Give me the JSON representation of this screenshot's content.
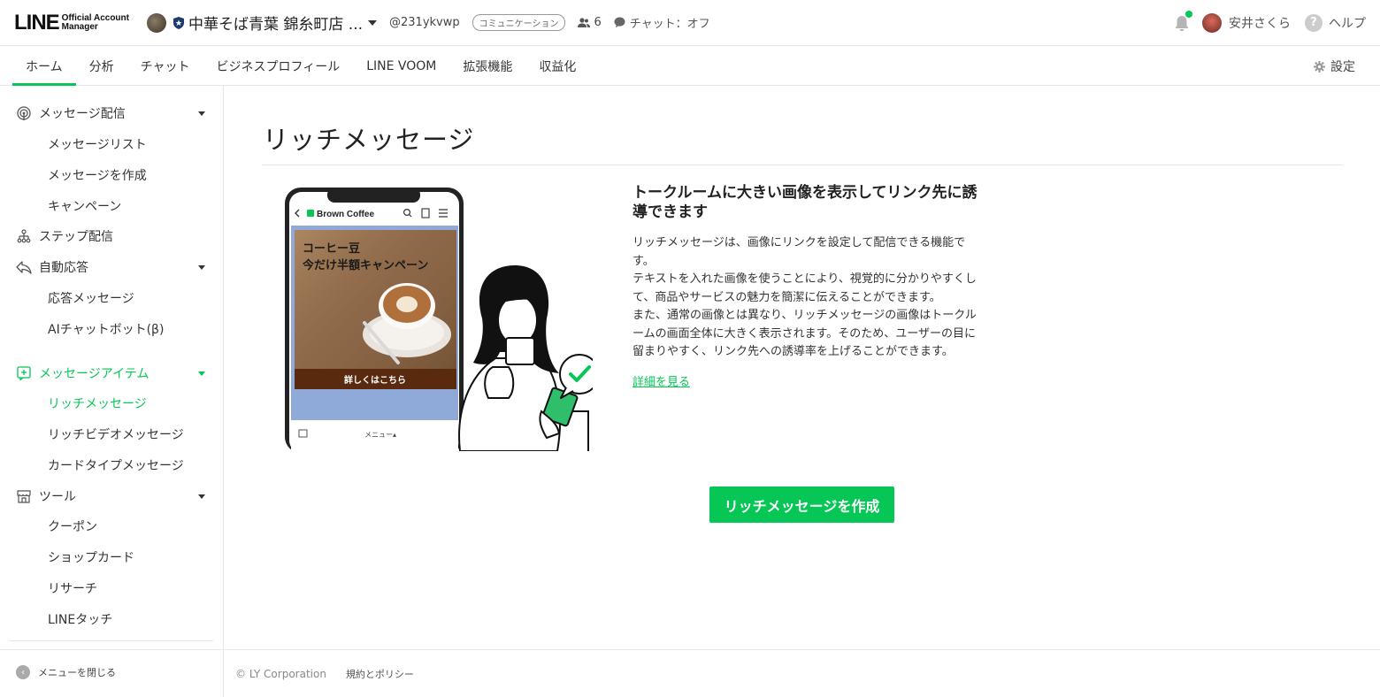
{
  "header": {
    "logo_main": "LINE",
    "logo_sub1": "Official Account",
    "logo_sub2": "Manager",
    "account_name": "中華そば青葉 錦糸町店 ...",
    "account_id": "@231ykvwp",
    "plan_badge": "コミュニケーション",
    "friend_count": "6",
    "chat_status": "チャット：オフ",
    "user_name": "安井さくら",
    "help_label": "ヘルプ"
  },
  "nav": {
    "tabs": [
      "ホーム",
      "分析",
      "チャット",
      "ビジネスプロフィール",
      "LINE VOOM",
      "拡張機能",
      "収益化"
    ],
    "active_tab": "ホーム",
    "settings_label": "設定"
  },
  "sidebar": {
    "sections": [
      {
        "label": "メッセージ配信",
        "icon": "broadcast-icon",
        "items": [
          "メッセージリスト",
          "メッセージを作成",
          "キャンペーン"
        ]
      },
      {
        "label": "ステップ配信",
        "icon": "step-icon",
        "items": []
      },
      {
        "label": "自動応答",
        "icon": "reply-icon",
        "items": [
          "応答メッセージ",
          "AIチャットボット(β)"
        ]
      },
      {
        "label": "メッセージアイテム",
        "icon": "message-item-icon",
        "items": [
          "リッチメッセージ",
          "リッチビデオメッセージ",
          "カードタイプメッセージ"
        ]
      },
      {
        "label": "ツール",
        "icon": "tool-icon",
        "items": [
          "クーポン",
          "ショップカード",
          "リサーチ",
          "LINEタッチ"
        ]
      }
    ],
    "active_item": "リッチメッセージ",
    "close_menu_label": "メニューを閉じる"
  },
  "main": {
    "title": "リッチメッセージ",
    "illustration": {
      "chat_name": "Brown Coffee",
      "banner_line1": "コーヒー豆",
      "banner_line2": "今だけ半額キャンペーン",
      "banner_button": "詳しくはこちら",
      "menu_label": "メニュー▴"
    },
    "desc_title": "トークルームに大きい画像を表示してリンク先に誘導できます",
    "desc_body": "リッチメッセージは、画像にリンクを設定して配信できる機能です。\nテキストを入れた画像を使うことにより、視覚的に分かりやすくして、商品やサービスの魅力を簡潔に伝えることができます。\nまた、通常の画像とは異なり、リッチメッセージの画像はトークルームの画面全体に大きく表示されます。そのため、ユーザーの目に留まりやすく、リンク先への誘導率を上げることができます。",
    "details_link": "詳細を見る",
    "create_button": "リッチメッセージを作成"
  },
  "footer": {
    "copyright": "© LY Corporation",
    "policy": "規約とポリシー"
  },
  "colors": {
    "accent": "#06c755",
    "banner_bg": "#8fa9d8",
    "banner_button": "#5a2a0e"
  }
}
